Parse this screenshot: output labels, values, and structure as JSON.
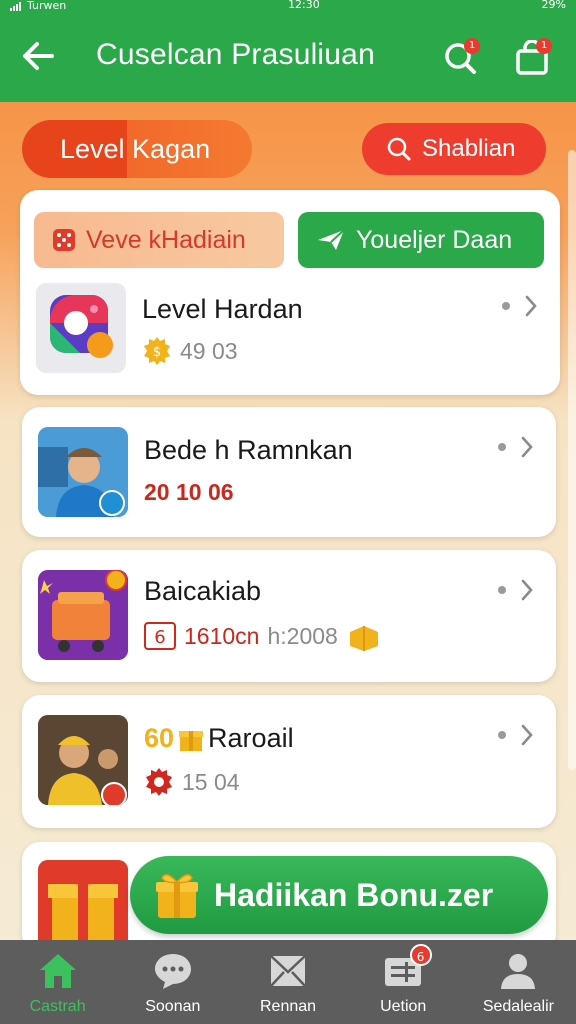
{
  "status_bar": {
    "carrier": "Turwen",
    "time": "12:30",
    "battery": "29%"
  },
  "header": {
    "title": "Cuselcan Prasuliuan",
    "search_badge": "1",
    "bag_badge": "1"
  },
  "filters": {
    "level_label": "Level Kagan",
    "search_label": "Shablian"
  },
  "tabs": {
    "left_label": "Veve kHadiain",
    "right_label": "Youeljer Daan"
  },
  "items": [
    {
      "title": "Level Hardan",
      "meta_value": "49 03"
    },
    {
      "title": "Bede h Ramnkan",
      "meta_value": "20 10 06"
    },
    {
      "title": "Baicakiab",
      "meta_value": "1610cn",
      "meta_extra": "h:2008"
    },
    {
      "title": "Raroail",
      "title_prefix": "60",
      "meta_value": "15 04"
    }
  ],
  "bonus_button": {
    "label": "Hadiikan Bonu.zer"
  },
  "bottom_nav": [
    {
      "label": "Castrah",
      "icon": "home-icon",
      "active": true
    },
    {
      "label": "Soonan",
      "icon": "chat-icon",
      "active": false
    },
    {
      "label": "Rennan",
      "icon": "mail-icon",
      "active": false
    },
    {
      "label": "Uetion",
      "icon": "ticket-icon",
      "active": false,
      "badge": "6"
    },
    {
      "label": "Sedalealir",
      "icon": "profile-icon",
      "active": false
    }
  ],
  "colors": {
    "primary_green": "#2aa84a",
    "accent_orange": "#f58a3a",
    "accent_red": "#ee3c2e",
    "price_red": "#c8281e"
  }
}
